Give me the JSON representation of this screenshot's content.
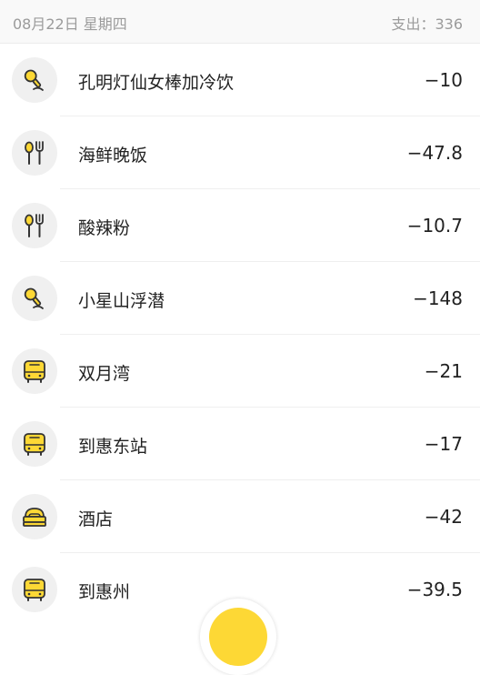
{
  "header": {
    "date": "08月22日 星期四",
    "total": "支出：336"
  },
  "colors": {
    "accent": "#fdd835",
    "icon_outline": "#333333",
    "icon_bg": "#f0f0f0"
  },
  "entries": [
    {
      "icon": "microphone-icon",
      "title": "孔明灯仙女棒加冷饮",
      "amount": "−10"
    },
    {
      "icon": "spoon-fork-icon",
      "title": "海鲜晚饭",
      "amount": "−47.8"
    },
    {
      "icon": "spoon-fork-icon",
      "title": "酸辣粉",
      "amount": "−10.7"
    },
    {
      "icon": "microphone-icon",
      "title": "小星山浮潜",
      "amount": "−148"
    },
    {
      "icon": "bus-icon",
      "title": "双月湾",
      "amount": "−21"
    },
    {
      "icon": "bus-icon",
      "title": "到惠东站",
      "amount": "−17"
    },
    {
      "icon": "bed-icon",
      "title": "酒店",
      "amount": "−42"
    },
    {
      "icon": "bus-icon",
      "title": "到惠州",
      "amount": "−39.5"
    }
  ]
}
